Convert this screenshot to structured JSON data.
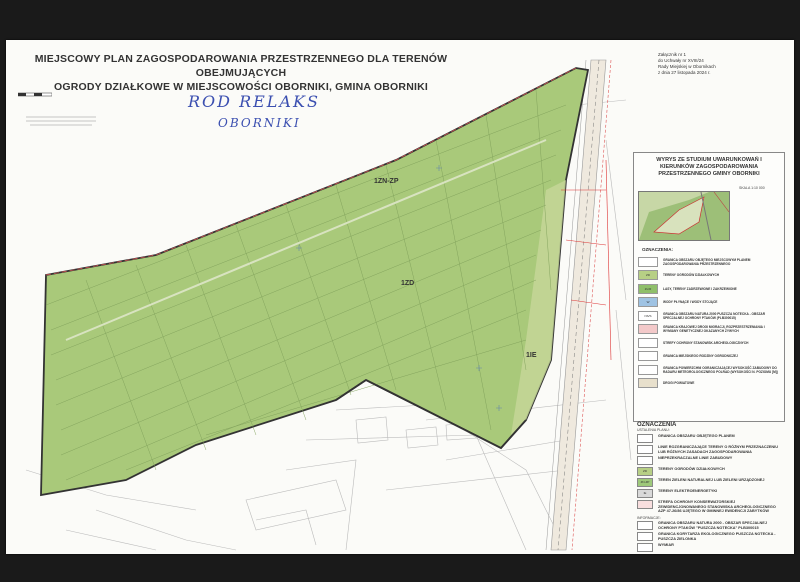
{
  "title_lines": [
    "MIEJSCOWY PLAN ZAGOSPODAROWANIA PRZESTRZENNEGO DLA TERENÓW OBEJMUJĄCYCH",
    "OGRODY DZIAŁKOWE W MIEJSCOWOŚCI OBORNIKI, GMINA OBORNIKI"
  ],
  "handwritten": [
    "ROD RELAKS",
    "OBORNIKI"
  ],
  "resolution_lines": [
    "Załącznik nr 1",
    "do Uchwały nr XVIII/24",
    "Rady Miejskiej w Obornikach",
    "z dnia 27 listopada 2024 r."
  ],
  "zone_labels": [
    "1ZN-ZP",
    "1ZD",
    "1IE"
  ],
  "inset": {
    "title": "WYRYS ZE STUDIUM UWARUNKOWAŃ I KIERUNKÓW ZAGOSPODAROWANIA PRZESTRZENNEGO GMINY OBORNIKI",
    "scale": "SKALA 1:10 000",
    "legend_heading": "OZNACZENIA:",
    "items": [
      {
        "code": "",
        "color": "#ffffff",
        "text": "GRANICA OBSZARU OBJĘTEGO MIEJSCOWYM PLANEM ZAGOSPODAROWANIA PRZESTRZENNEGO"
      },
      {
        "code": "ZD",
        "color": "#b7cf85",
        "text": "TERENY OGRODÓW DZIAŁKOWYCH"
      },
      {
        "code": "ZL/R",
        "color": "#8fbf6a",
        "text": "LASY, TERENY ZADRZEWIONE I ZAKRZEWIONE"
      },
      {
        "code": "W",
        "color": "#9fc3e3",
        "text": "WODY PŁYNĄCE I WODY STOJĄCE"
      },
      {
        "code": "NS/S",
        "color": "#ffffff",
        "text": "GRANICA OBSZARU NATURA 2000 PUSZCZA NOTECKA - OBSZAR SPECJALNEJ OCHRONY PTAKÓW (PLB300015)"
      },
      {
        "code": "",
        "color": "#f3c9c9",
        "text": "GRANICA KRAJOWEJ DROGI MIGRACJI, ROZPRZESTRZENIANIA I WYMIANY GENETYCZNEJ OKAZANYCH ŻYWYCH"
      },
      {
        "code": "",
        "color": "#ffffff",
        "text": "STREFY OCHRONY STANOWISK ARCHEOLOGICZNYCH"
      },
      {
        "code": "",
        "color": "#ffffff",
        "text": "GRANICA MIEJSKIEGO RODZINY OGRODNICZEJ"
      },
      {
        "code": "",
        "color": "#ffffff",
        "text": "GRANICA POWIERZCHNI OGRANICZAJĄCEJ WYSOKOŚĆ ZABUDOWY DO RADARU METEOROLOGICZNEGO POLRAD (WYSOKOŚCI N. POZIOMU [M])"
      },
      {
        "code": "",
        "color": "#e8e0cc",
        "text": "DROGI POWIATOWE"
      }
    ]
  },
  "legend": {
    "title": "OZNACZENIA",
    "subtitle": "USTALENIA PLANU:",
    "items": [
      {
        "code": "",
        "color": "#ffffff",
        "text": "GRANICA OBSZARU OBJĘTEGO PLANEM"
      },
      {
        "code": "",
        "color": "#ffffff",
        "text": "LINIE ROZGRANICZAJĄCE TERENY O RÓŻNYM PRZEZNACZENIU LUB RÓŻNYCH ZASADACH ZAGOSPODAROWANIA"
      },
      {
        "code": "",
        "color": "#ffffff",
        "text": "NIEPRZEKRACZALNE LINIE ZABUDOWY"
      },
      {
        "code": "ZD",
        "color": "#b7cf85",
        "text": "TERENY OGRODÓW DZIAŁKOWYCH"
      },
      {
        "code": "ZN-ZP",
        "color": "#9ec97a",
        "text": "TEREN ZIELENI NATURALNEJ LUB ZIELENI URZĄDZONEJ"
      },
      {
        "code": "IE",
        "color": "#d9d9d9",
        "text": "TERENY ELEKTROENERGETYKI"
      },
      {
        "code": "",
        "color": "#f8dede",
        "text": "STREFA OCHRONY KONSERWATORSKIEJ ZEWIDENCJONOWANEGO STANOWISKA ARCHEOLOGICZNEGO AZP 47-26/86 UJĘTEGO W GMINNEJ EWIDENCJI ZABYTKÓW"
      }
    ],
    "info_heading": "INFORMACJE:",
    "info_items": [
      {
        "code": "",
        "color": "#ffffff",
        "text": "GRANICA OBSZARU NATURA 2000 - OBSZAR SPECJALNEJ OCHRONY PTAKÓW \"PUSZCZA NOTECKA\" PLB300015"
      },
      {
        "code": "",
        "color": "#ffffff",
        "text": "GRANICA KORYTARZA EKOLOGICZNEGO PUSZCZA NOTECKA - PUSZCZA ZIELONKA"
      },
      {
        "code": "",
        "color": "#ffffff",
        "text": "WYMIAR"
      }
    ]
  }
}
